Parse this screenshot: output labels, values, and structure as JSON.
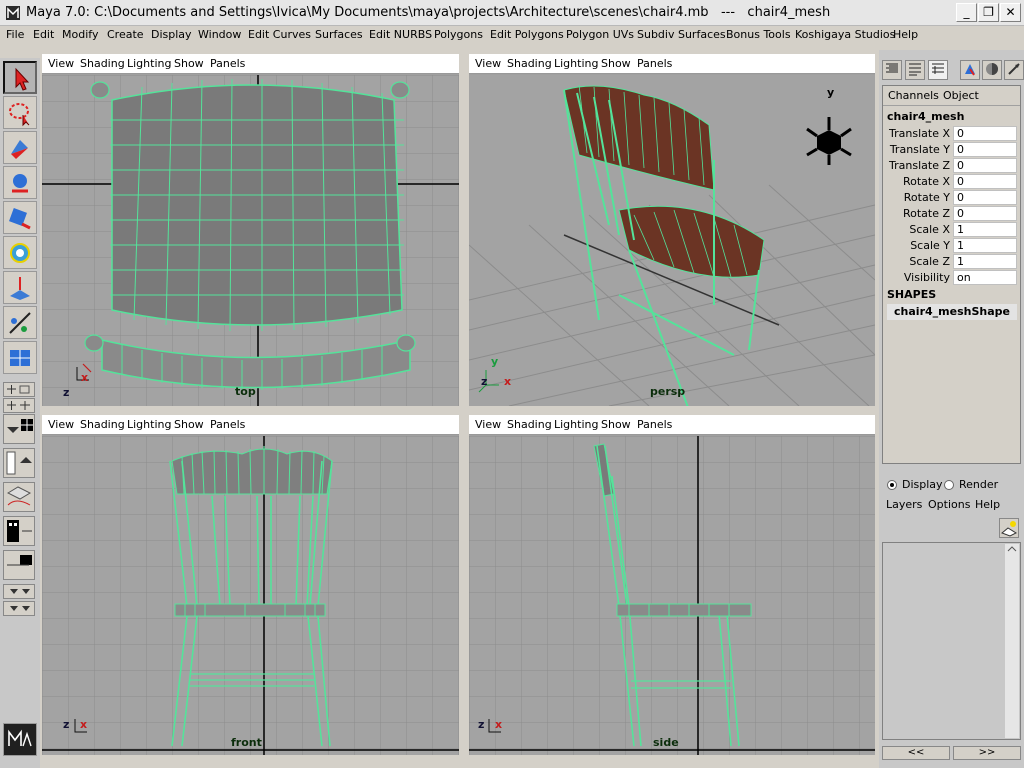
{
  "window": {
    "title": "Maya 7.0: C:\\Documents and Settings\\Ivica\\My Documents\\maya\\projects\\Architecture\\scenes\\chair4.mb   ---   chair4_mesh",
    "minimize": "_",
    "maximize": "❐",
    "close": "✕"
  },
  "menubar": [
    "File",
    "Edit",
    "Modify",
    "Create",
    "Display",
    "Window",
    "Edit Curves",
    "Surfaces",
    "Edit NURBS",
    "Polygons",
    "Edit Polygons",
    "Polygon UVs",
    "Subdiv Surfaces",
    "Bonus Tools",
    "Koshigaya Studios",
    "Help"
  ],
  "viewport_menu": [
    "View",
    "Shading",
    "Lighting",
    "Show",
    "Panels"
  ],
  "viewports": {
    "top": {
      "camera": "top"
    },
    "persp": {
      "camera": "persp"
    },
    "front": {
      "camera": "front"
    },
    "side": {
      "camera": "side"
    }
  },
  "axes": {
    "x": "x",
    "y": "y",
    "z": "z"
  },
  "channel_box": {
    "tabs": [
      "Channels",
      "Object"
    ],
    "object_name": "chair4_mesh",
    "attributes": [
      {
        "label": "Translate X",
        "value": "0"
      },
      {
        "label": "Translate Y",
        "value": "0"
      },
      {
        "label": "Translate Z",
        "value": "0"
      },
      {
        "label": "Rotate X",
        "value": "0"
      },
      {
        "label": "Rotate Y",
        "value": "0"
      },
      {
        "label": "Rotate Z",
        "value": "0"
      },
      {
        "label": "Scale X",
        "value": "1"
      },
      {
        "label": "Scale Y",
        "value": "1"
      },
      {
        "label": "Scale Z",
        "value": "1"
      },
      {
        "label": "Visibility",
        "value": "on"
      }
    ],
    "shapes_title": "SHAPES",
    "shape_name": "chair4_meshShape"
  },
  "layer_editor": {
    "display_label": "Display",
    "render_label": "Render",
    "display_selected": true,
    "menu": [
      "Layers",
      "Options",
      "Help"
    ],
    "prev": "<<",
    "next": ">>"
  },
  "colors": {
    "wire": "#54e39a",
    "wood": "#6b3424",
    "viewport_bg": "#a3a3a3",
    "grid": "#8c8c8c"
  }
}
